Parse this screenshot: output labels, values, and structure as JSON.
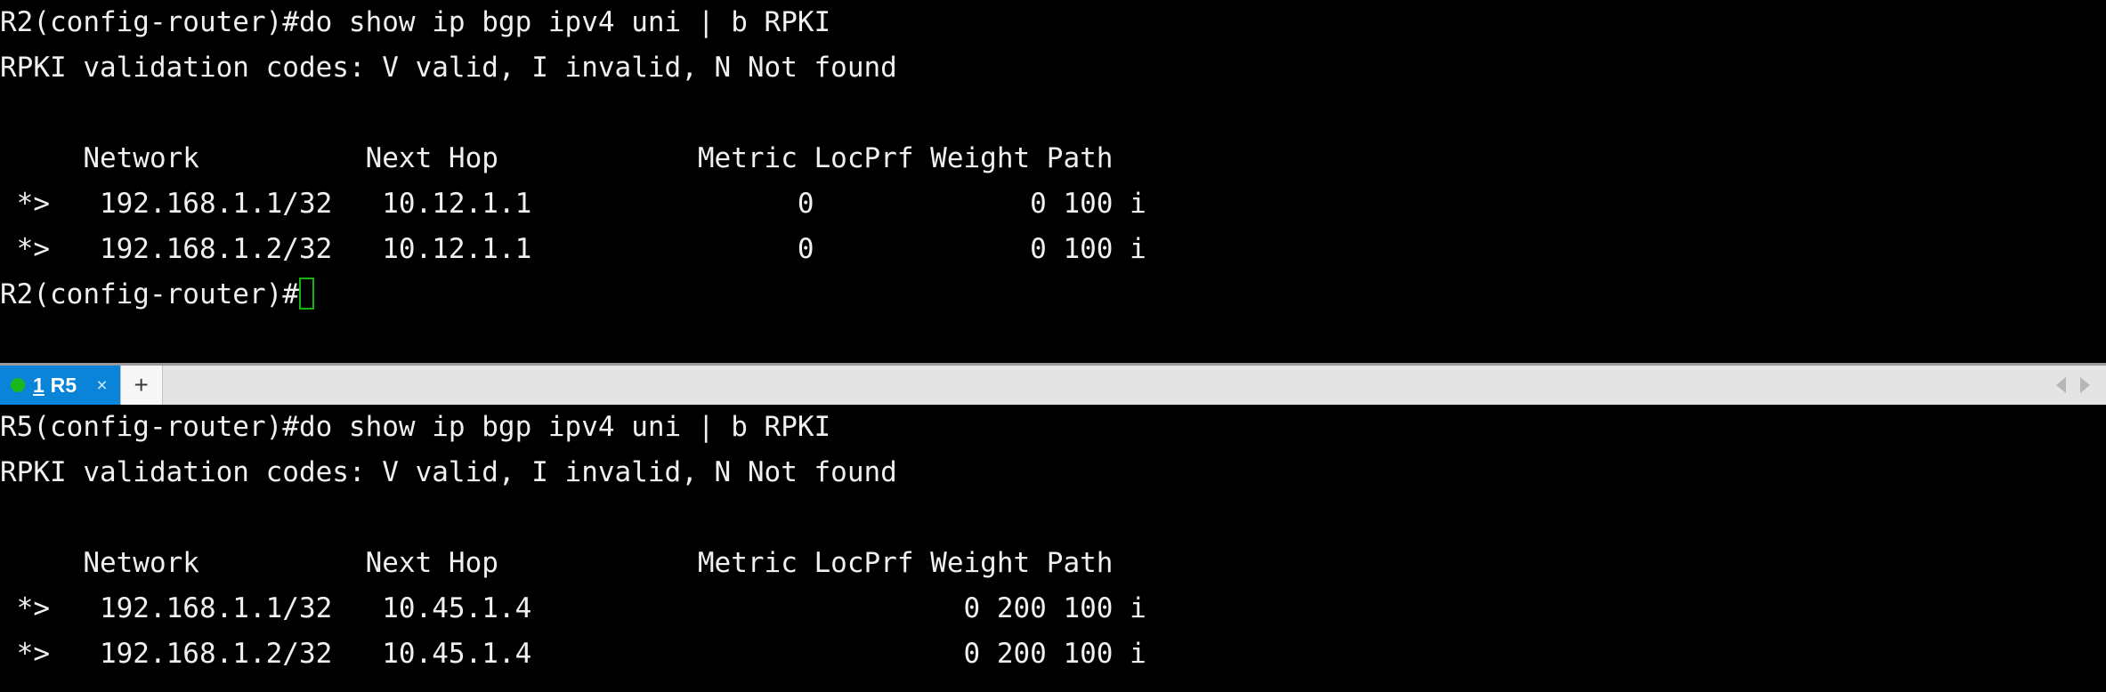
{
  "colors": {
    "terminal_background": "#000000",
    "terminal_text": "#f0f0f0",
    "tab_active_background": "#0a84d8",
    "tab_active_text": "#ffffff",
    "tabbar_background": "#e4e4e4",
    "status_dot": "#1bb81b",
    "cursor_outline": "#12b512"
  },
  "top_terminal": {
    "name": "R2 terminal pane",
    "lines": [
      "R2(config-router)#do show ip bgp ipv4 uni | b RPKI",
      "RPKI validation codes: V valid, I invalid, N Not found",
      "",
      "     Network          Next Hop            Metric LocPrf Weight Path",
      " *>   192.168.1.1/32   10.12.1.1                0             0 100 i",
      " *>   192.168.1.2/32   10.12.1.1                0             0 100 i"
    ],
    "prompt": "R2(config-router)#",
    "cursor": "block-outline-cursor",
    "command": "do show ip bgp ipv4 uni | b RPKI",
    "legend": "RPKI validation codes: V valid, I invalid, N Not found",
    "table": {
      "columns": [
        "Network",
        "Next Hop",
        "Metric",
        "LocPrf",
        "Weight",
        "Path"
      ],
      "rows": [
        {
          "status": "*>",
          "Network": "192.168.1.1/32",
          "Next Hop": "10.12.1.1",
          "Metric": "0",
          "LocPrf": "",
          "Weight": "0",
          "Path": "100 i"
        },
        {
          "status": "*>",
          "Network": "192.168.1.2/32",
          "Next Hop": "10.12.1.1",
          "Metric": "0",
          "LocPrf": "",
          "Weight": "0",
          "Path": "100 i"
        }
      ]
    }
  },
  "tabbar": {
    "active_tab": {
      "index_label": "1",
      "title": "R5",
      "close_label": "×",
      "status": "connected"
    },
    "new_tab_label": "+",
    "scroll_left_label": "◀",
    "scroll_right_label": "▶"
  },
  "bottom_terminal": {
    "name": "R5 terminal pane",
    "lines": [
      "R5(config-router)#do show ip bgp ipv4 uni | b RPKI",
      "RPKI validation codes: V valid, I invalid, N Not found",
      "",
      "     Network          Next Hop            Metric LocPrf Weight Path",
      " *>   192.168.1.1/32   10.45.1.4                          0 200 100 i",
      " *>   192.168.1.2/32   10.45.1.4                          0 200 100 i"
    ],
    "prompt": "R5(config-router)#",
    "command": "do show ip bgp ipv4 uni | b RPKI",
    "legend": "RPKI validation codes: V valid, I invalid, N Not found",
    "table": {
      "columns": [
        "Network",
        "Next Hop",
        "Metric",
        "LocPrf",
        "Weight",
        "Path"
      ],
      "rows": [
        {
          "status": "*>",
          "Network": "192.168.1.1/32",
          "Next Hop": "10.45.1.4",
          "Metric": "",
          "LocPrf": "",
          "Weight": "0",
          "Path": "200 100 i"
        },
        {
          "status": "*>",
          "Network": "192.168.1.2/32",
          "Next Hop": "10.45.1.4",
          "Metric": "",
          "LocPrf": "",
          "Weight": "0",
          "Path": "200 100 i"
        }
      ]
    }
  }
}
